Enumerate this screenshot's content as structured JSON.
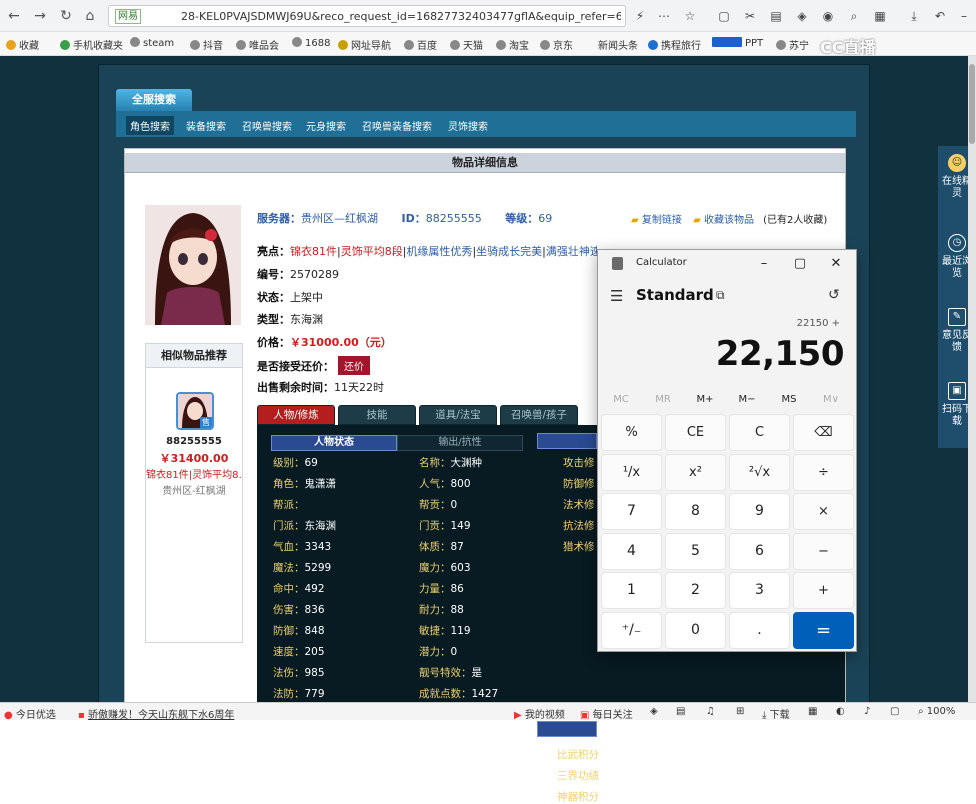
{
  "browser": {
    "url_badge": "网易",
    "url": "28-KEL0PVAJSDMWJ69U&reco_request_id=16827732403477gflA&equip_refer=65",
    "bookmarks": [
      "收藏",
      "手机收藏夹",
      "steam",
      "抖音",
      "唯品会",
      "1688",
      "网址导航",
      "百度",
      "天猫",
      "淘宝",
      "京东",
      "新闻头条",
      "携程旅行",
      "PPT",
      "苏宁"
    ],
    "cc_logo": "CC直播",
    "status": {
      "left": "今日优选",
      "news": "骄傲赚发！今天山东舰下水6周年",
      "video": "我的视频",
      "focus": "每日关注",
      "download": "下载",
      "zoom": "100%"
    }
  },
  "site": {
    "nav_title": "全服搜索",
    "nav_items": [
      "角色搜索",
      "装备搜索",
      "召唤兽搜索",
      "元身搜索",
      "召唤兽装备搜索",
      "灵饰搜索"
    ],
    "content_title": "物品详细信息",
    "server_label": "服务器：",
    "server": "贵州区—红枫湖",
    "id_label": "ID：",
    "id": "88255555",
    "level_label": "等级：",
    "level": "69",
    "copy_link": "复制链接",
    "favorite": "收藏该物品",
    "fav_count": "(已有2人收藏)",
    "highlight_label": "亮点：",
    "highlights": [
      "锦衣81件",
      "灵饰平均8段",
      "机缘属性优秀",
      "坐骑成长完美",
      "满强壮神速"
    ],
    "code_label": "编号：",
    "code": "2570289",
    "state_label": "状态：",
    "state": "上架中",
    "type_label": "类型：",
    "type": "东海渊",
    "price_label": "价格：",
    "price": "￥31000.00（元）",
    "bargain_label": "是否接受还价：",
    "bargain_btn": "还价",
    "remain_label": "出售剩余时间：",
    "remain": "11天22时",
    "similar_title": "相似物品推荐",
    "similar_id": "88255555",
    "similar_price": "￥31400.00",
    "similar_desc": "锦衣81件|灵饰平均8…",
    "similar_server": "贵州区-红枫湖",
    "sale_badge": "售",
    "game_tabs": [
      "人物/修炼",
      "技能",
      "道具/法宝",
      "召唤兽/孩子"
    ],
    "stat_tabs": [
      "人物状态",
      "输出/抗性"
    ],
    "stats_left": [
      [
        "级别：",
        "69"
      ],
      [
        "角色：",
        "鬼潇潇"
      ],
      [
        "帮派：",
        ""
      ],
      [
        "门派：",
        "东海渊"
      ],
      [
        "气血：",
        "3343"
      ],
      [
        "魔法：",
        "5299"
      ],
      [
        "命中：",
        "492"
      ],
      [
        "伤害：",
        "836"
      ],
      [
        "防御：",
        "848"
      ],
      [
        "速度：",
        "205"
      ],
      [
        "法伤：",
        "985"
      ],
      [
        "法防：",
        "779"
      ]
    ],
    "stats_mid": [
      [
        "名称：",
        "大渊种"
      ],
      [
        "人气：",
        "800"
      ],
      [
        "帮贡：",
        "0"
      ],
      [
        "门贡：",
        "149"
      ],
      [
        "体质：",
        "87"
      ],
      [
        "魔力：",
        "603"
      ],
      [
        "力量：",
        "86"
      ],
      [
        "耐力：",
        "88"
      ],
      [
        "敏捷：",
        "119"
      ],
      [
        "潜力：",
        "0"
      ],
      [
        "靓号特效：",
        "是"
      ],
      [
        "成就点数：",
        "1427"
      ]
    ],
    "stats_right": [
      "攻击修",
      "防御修",
      "法术修",
      "抗法修",
      "猎术修"
    ],
    "stats_right2": [
      "比武积分",
      "三界功绩",
      "神器积分"
    ]
  },
  "sidebar": [
    {
      "icon": "face",
      "label": "在线精灵"
    },
    {
      "icon": "clock",
      "label": "最近浏览"
    },
    {
      "icon": "edit",
      "label": "意见反馈"
    },
    {
      "icon": "scan",
      "label": "扫码下载"
    }
  ],
  "calculator": {
    "title": "Calculator",
    "mode": "Standard",
    "expression": "22150 +",
    "display": "22,150",
    "memory": [
      "MC",
      "MR",
      "M+",
      "M−",
      "MS",
      "M∨"
    ],
    "keys": [
      [
        "%",
        "CE",
        "C",
        "⌫"
      ],
      [
        "¹/x",
        "x²",
        "²√x",
        "÷"
      ],
      [
        "7",
        "8",
        "9",
        "×"
      ],
      [
        "4",
        "5",
        "6",
        "−"
      ],
      [
        "1",
        "2",
        "3",
        "+"
      ],
      [
        "⁺/₋",
        "0",
        ".",
        "="
      ]
    ]
  }
}
